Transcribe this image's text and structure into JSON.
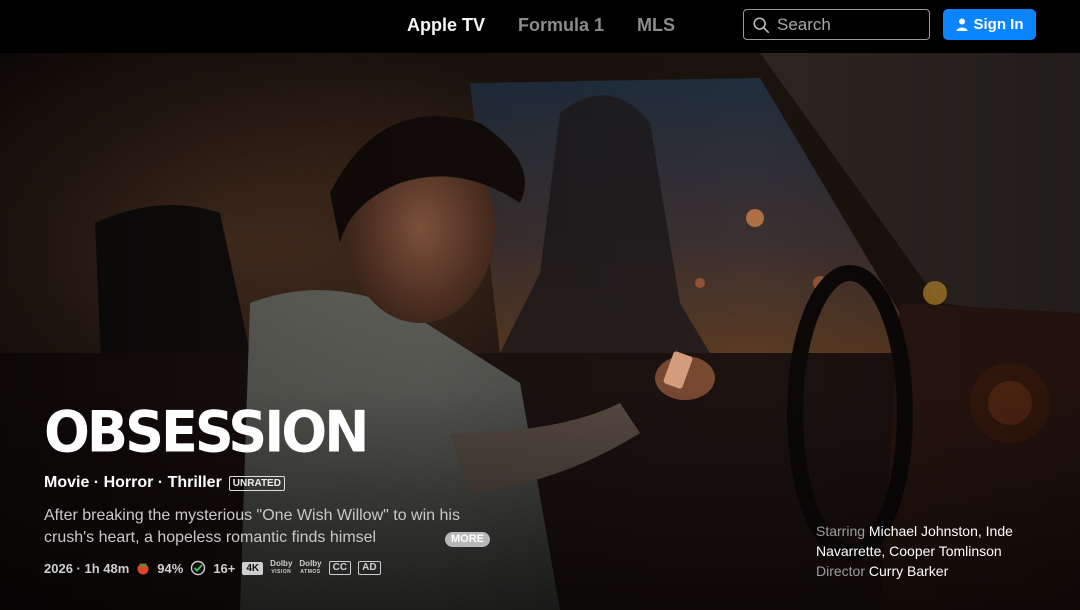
{
  "nav": {
    "tabs": [
      {
        "label": "Apple TV",
        "active": true
      },
      {
        "label": "Formula 1",
        "active": false
      },
      {
        "label": "MLS",
        "active": false
      }
    ],
    "search_placeholder": "Search",
    "signin_label": "Sign In"
  },
  "hero": {
    "title": "OBSESSION",
    "genres": "Movie · Horror · Thriller",
    "rating": "UNRATED",
    "synopsis": "After breaking the mysterious \"One Wish Willow\" to win his crush's heart, a hopeless romantic finds himsel",
    "more_label": "MORE",
    "meta": {
      "year_runtime": "2026 · 1h 48m",
      "score": "94%",
      "age": "16+",
      "quality": "4K",
      "dolby_vision": "Dolby",
      "dolby_vision_sub": "VISION",
      "dolby_atmos": "Dolby",
      "dolby_atmos_sub": "ATMOS",
      "cc": "CC",
      "ad": "AD"
    },
    "credits": {
      "starring_label": "Starring",
      "starring": "Michael Johnston, Inde Navarrette, Cooper Tomlinson",
      "director_label": "Director",
      "director": "Curry Barker"
    }
  },
  "colors": {
    "accent": "#0a84ff",
    "nav_active": "#f5f5f5",
    "nav_inactive": "#8c8c8c"
  }
}
